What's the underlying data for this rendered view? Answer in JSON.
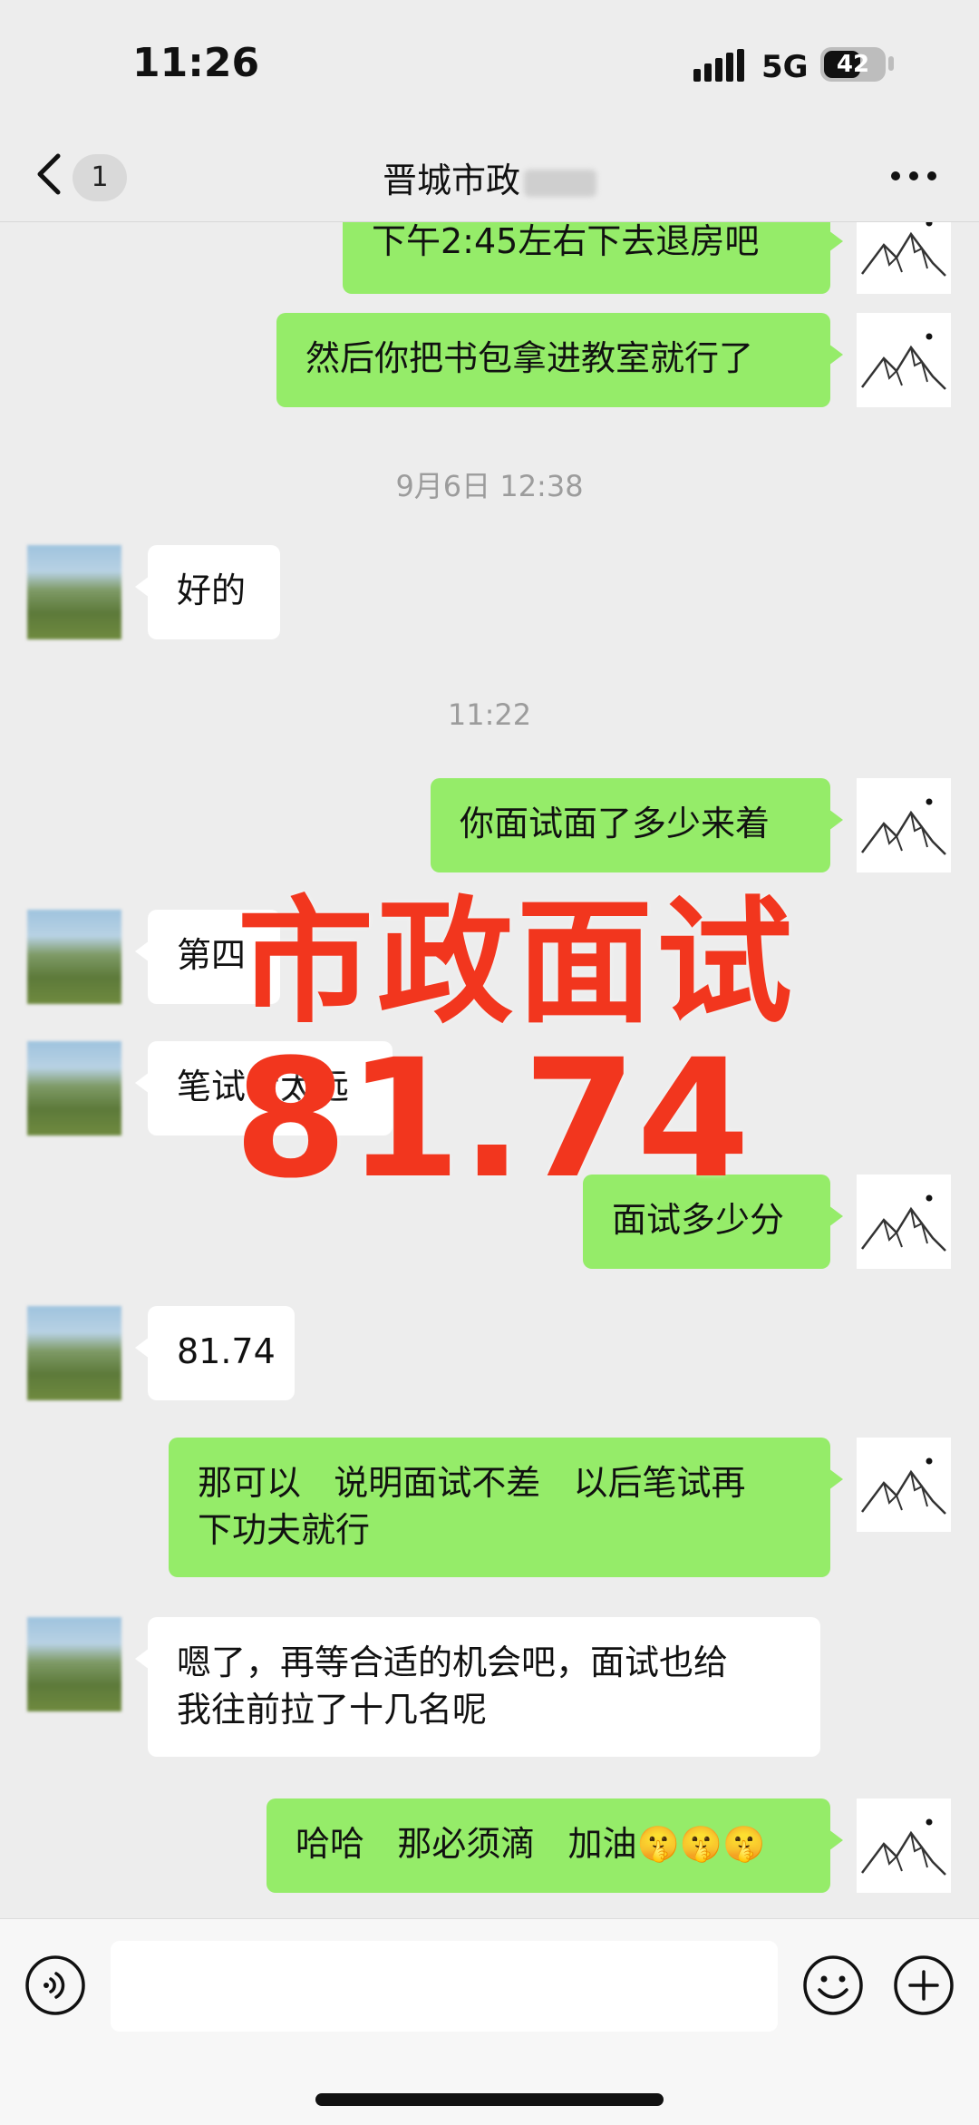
{
  "status": {
    "time": "11:26",
    "network": "5G",
    "battery": "42"
  },
  "header": {
    "unread_count": "1",
    "title": "晋城市政"
  },
  "messages": {
    "m1": "下午2:45左右下去退房吧",
    "m2": "然后你把书包拿进教室就行了",
    "t1": "9月6日 12:38",
    "m3": "好的",
    "t2": "11:22",
    "m4": "你面试面了多少来着",
    "m5": "第四",
    "m6": "笔试考太远",
    "m7": "面试多少分",
    "m8": "81.74",
    "m9": "那可以   说明面试不差   以后笔试再\n下功夫就行",
    "m10": "嗯了，再等合适的机会吧，面试也给\n我往前拉了十几名呢",
    "m11": "哈哈   那必须滴   加油🤫🤫🤫"
  },
  "overlay": {
    "title": "市政面试",
    "score": "81.74"
  },
  "composer": {
    "placeholder": ""
  }
}
